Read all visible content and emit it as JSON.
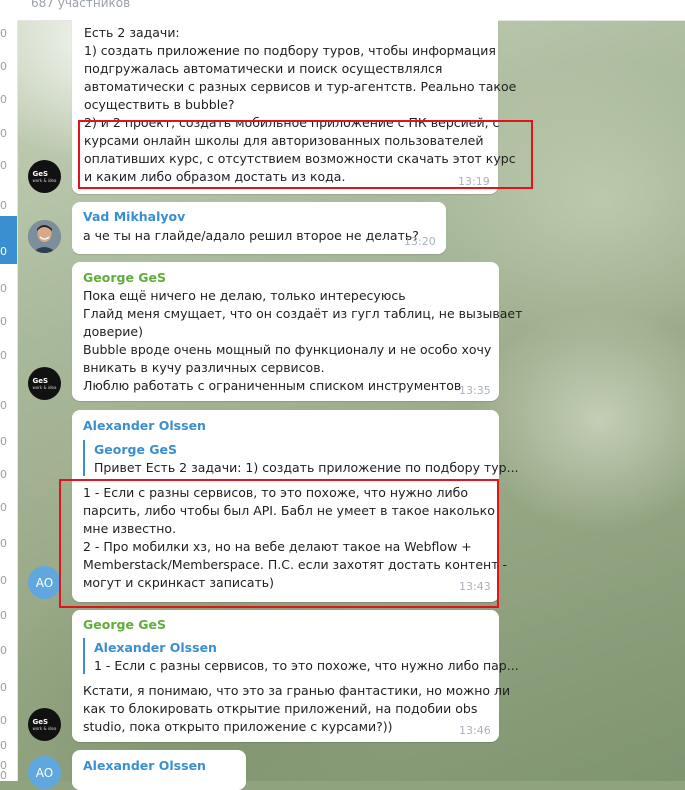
{
  "header": {
    "members": "687 участников"
  },
  "left_digits": [
    "0",
    "0",
    "0",
    "0",
    "0",
    "0",
    "0",
    "0",
    "0",
    "0",
    "0",
    "0",
    "0",
    "0",
    "0",
    "0",
    "0",
    "0",
    "0",
    "0",
    "0",
    "0",
    "0"
  ],
  "messages": {
    "m1": {
      "lines": [
        "Есть 2 задачи:",
        "1) создать приложение по подбору туров, чтобы информация",
        "подгружалась автоматически и поиск осуществлялся",
        "автоматически с разных сервисов и тур-агентств. Реально такое",
        "осуществить в bubble?",
        "2) и 2 проект, создать мобильное приложение с ПК версией, с",
        "курсами онлайн школы для авторизованных пользователей",
        "оплативших курс, с отсутствием возможности скачать этот курс",
        "и каким либо образом достать из кода."
      ],
      "time": "13:19"
    },
    "m2": {
      "author": "Vad Mikhalyov",
      "lines": [
        "а че ты на глайде/адало решил второе не делать?"
      ],
      "time": "13:20"
    },
    "m3": {
      "author": "George GeS",
      "lines": [
        "Пока ещё ничего не делаю, только интересуюсь",
        "Глайд меня смущает, что он создаёт из гугл таблиц, не вызывает",
        "доверие)",
        "Bubble вроде очень мощный по функционалу и не особо хочу",
        "вникать в кучу различных сервисов.",
        "Люблю работать с ограниченным списком инструментов"
      ],
      "time": "13:35"
    },
    "m4": {
      "author": "Alexander Olssen",
      "quote_author": "George GeS",
      "quote_text": "Привет Есть 2 задачи: 1) создать приложение по подбору тур...",
      "lines": [
        "1 - Если с разны сервисов, то это похоже, что нужно либо",
        "парсить, либо чтобы был API. Бабл не умеет в такое наколько",
        "мне известно.",
        "2 - Про мобилки хз, но на вебе делают такое на Webflow +",
        "Memberstack/Memberspace. П.С. если захотят достать контент -",
        "могут и скринкаст записать)"
      ],
      "time": "13:43"
    },
    "m5": {
      "author": "George GeS",
      "quote_author": "Alexander Olssen",
      "quote_text": "1 - Если с разны сервисов, то это похоже, что нужно либо пар...",
      "lines": [
        "Кстати, я понимаю, что это за гранью фантастики, но можно ли",
        "как то блокировать открытие приложений, на подобии obs",
        "studio, пока открыто приложение с курсами?))"
      ],
      "time": "13:46"
    },
    "m6": {
      "author": "Alexander Olssen"
    }
  },
  "avatars": {
    "ges_logo": "GeS",
    "ges_sub": "work & idea",
    "ao_initials": "AO"
  },
  "colors": {
    "accent_blue": "#3a8fd0",
    "author_green": "#5fae3c",
    "highlight_red": "#e0141a",
    "time_gray": "#a7b3bf"
  }
}
